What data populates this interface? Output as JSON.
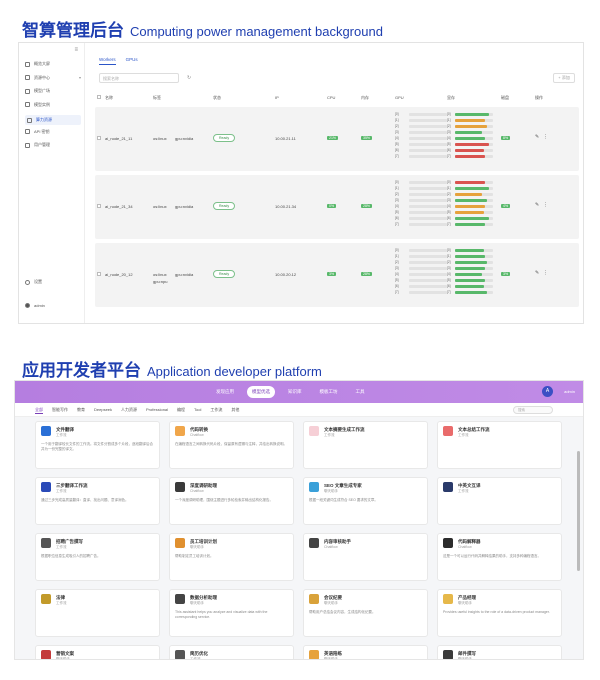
{
  "section1": {
    "title_cn": "智算管理后台",
    "title_en": "Computing power management background"
  },
  "section2": {
    "title_cn": "应用开发者平台",
    "title_en": "Application developer platform"
  },
  "admin": {
    "sidebar": {
      "items": [
        {
          "label": "概览大屏",
          "icon": "dashboard-icon"
        },
        {
          "label": "资源中心",
          "icon": "resource-icon"
        },
        {
          "label": "模型广场",
          "icon": "model-icon"
        },
        {
          "label": "模型实例",
          "icon": "instance-icon"
        },
        {
          "label": "算力资源",
          "icon": "compute-icon"
        },
        {
          "label": "API 密钥",
          "icon": "key-icon"
        },
        {
          "label": "用户管理",
          "icon": "user-icon"
        }
      ],
      "settings_label": "设置",
      "user_label": "admin"
    },
    "tabs": [
      "Workers",
      "GPUs"
    ],
    "search_placeholder": "搜索名称",
    "add_label": "+ 添加",
    "columns": [
      "名称",
      "标签",
      "状态",
      "IP",
      "CPU",
      "内存",
      "GPU",
      "显存",
      "磁盘",
      "操作"
    ],
    "rows": [
      {
        "name": "ai_node_21_11",
        "labels": [
          "os:linux",
          "gpu:nvidia"
        ],
        "status": "Ready",
        "ip": "10.00.21.11",
        "cpu": "21%",
        "mem": "35%",
        "disk": "8%"
      },
      {
        "name": "ai_node_21_34",
        "labels": [
          "os:linux",
          "gpu:nvidia"
        ],
        "status": "Ready",
        "ip": "10.00.21.34",
        "cpu": "0%",
        "mem": "28%",
        "disk": "4%"
      },
      {
        "name": "ai_node_20_12",
        "labels": [
          "os:linux",
          "gpu:nvidia",
          "gpu:npu"
        ],
        "status": "Ready",
        "ip": "10.00.20.12",
        "cpu": "3%",
        "mem": "28%",
        "disk": "3%"
      }
    ],
    "colors": {
      "ok": "#58b86a",
      "warn": "#e6a23c",
      "danger": "#d9534f"
    }
  },
  "dev": {
    "nav": [
      "发现应用",
      "模型优选",
      "知识库",
      "模板工坊",
      "工具"
    ],
    "nav_selected": 1,
    "user": "admin",
    "categories": [
      "全部",
      "智能写作",
      "教育",
      "Deepseek",
      "人力资源",
      "Professional",
      "编程",
      "Tool",
      "工作流",
      "其他"
    ],
    "search_placeholder": "搜索",
    "cards": [
      {
        "title": "文件翻译",
        "tag": "工作流",
        "desc": "一个用于翻译较长文件的工作流。将文件分割成多个片段，逐段翻译后合并为一份完整的译文。",
        "color": "#2a6fd6"
      },
      {
        "title": "代码转换",
        "tag": "Chatflow",
        "desc": "在编程语言之间转换代码片段，保留原有逻辑与注释，并给出转换说明。",
        "color": "#f0a64a"
      },
      {
        "title": "文本摘要生成工作流",
        "tag": "工作流",
        "desc": "",
        "color": "#f6cfd6"
      },
      {
        "title": "文本总结工作流",
        "tag": "工作流",
        "desc": "",
        "color": "#e96b6b"
      },
      {
        "title": "三步翻译工作流",
        "tag": "工作流",
        "desc": "通过三步完成高质量翻译：直译、找出问题、意译润色。",
        "color": "#2a4ab8"
      },
      {
        "title": "深度调研助理",
        "tag": "Chatflow",
        "desc": "一个深度调研助理，围绕主题进行多轮检索并输出结构化报告。",
        "color": "#3a3a3a"
      },
      {
        "title": "SEO 文章生成专家",
        "tag": "聊天助手",
        "desc": "根据一段关键词生成符合 SEO 要求的文章。",
        "color": "#3aa0d9"
      },
      {
        "title": "中英文互译",
        "tag": "工作流",
        "desc": "",
        "color": "#2a3a6a"
      },
      {
        "title": "招聘广告撰写",
        "tag": "工作流",
        "desc": "根据职位信息生成吸引人的招聘广告。",
        "color": "#555555"
      },
      {
        "title": "员工培训计划",
        "tag": "聊天助手",
        "desc": "帮助制定员工培训计划。",
        "color": "#e0902f"
      },
      {
        "title": "内容审核助手",
        "tag": "Chatflow",
        "desc": "",
        "color": "#444444"
      },
      {
        "title": "代码解释器",
        "tag": "Chatflow",
        "desc": "这是一个可以运行代码并解释结果的助手，支持多种编程语言。",
        "color": "#2c2c2c"
      },
      {
        "title": "法律",
        "tag": "工作流",
        "desc": "",
        "color": "#c29a2a"
      },
      {
        "title": "数据分析助理",
        "tag": "聊天助手",
        "desc": "This assistant helps you analyze and visualize data with the corresponding service.",
        "color": "#444444"
      },
      {
        "title": "会议纪要",
        "tag": "聊天助手",
        "desc": "帮助用户总结会议内容，生成结构化纪要。",
        "color": "#d9a23a"
      },
      {
        "title": "产品经理",
        "tag": "聊天助手",
        "desc": "Provides useful insights to the role of a data-driven product manager.",
        "color": "#e6b84a"
      },
      {
        "title": "营销文案",
        "tag": "聊天助手",
        "desc": "",
        "color": "#c33a3a"
      },
      {
        "title": "简历优化",
        "tag": "工作流",
        "desc": "",
        "color": "#555555"
      },
      {
        "title": "英语陪练",
        "tag": "聊天助手",
        "desc": "",
        "color": "#e6a23c"
      },
      {
        "title": "邮件撰写",
        "tag": "聊天助手",
        "desc": "",
        "color": "#3a3a3a"
      }
    ]
  }
}
